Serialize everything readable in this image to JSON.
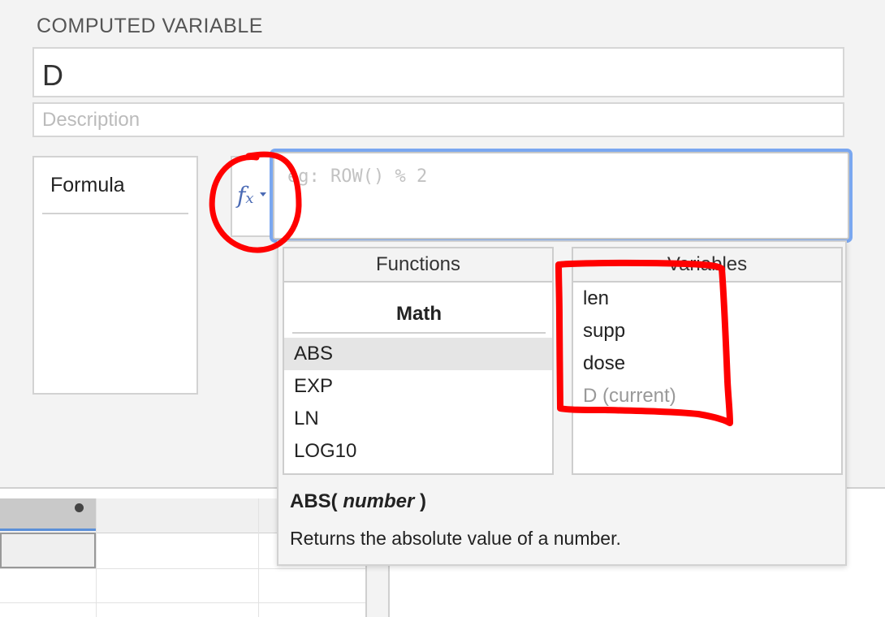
{
  "section": {
    "title": "COMPUTED VARIABLE"
  },
  "name_input": {
    "value": "D"
  },
  "description_input": {
    "placeholder": "Description"
  },
  "variable_type": {
    "selected": "Formula"
  },
  "formula": {
    "placeholder": "eg: ROW() % 2"
  },
  "functions_panel": {
    "header": "Functions",
    "group": "Math",
    "items": [
      "ABS",
      "EXP",
      "LN",
      "LOG10"
    ],
    "selected": "ABS"
  },
  "variables_panel": {
    "header": "Variables",
    "items": [
      "len",
      "supp",
      "dose",
      "D (current)"
    ]
  },
  "help": {
    "function_name": "ABS(",
    "argument": "number",
    "closing": ")",
    "description": "Returns the absolute value of a number."
  },
  "colors": {
    "annotation": "#ff0000",
    "focus_ring": "#7aa7f0",
    "fx_icon": "#4b6bb5"
  },
  "icons": {
    "formula_button": "fx-icon"
  }
}
